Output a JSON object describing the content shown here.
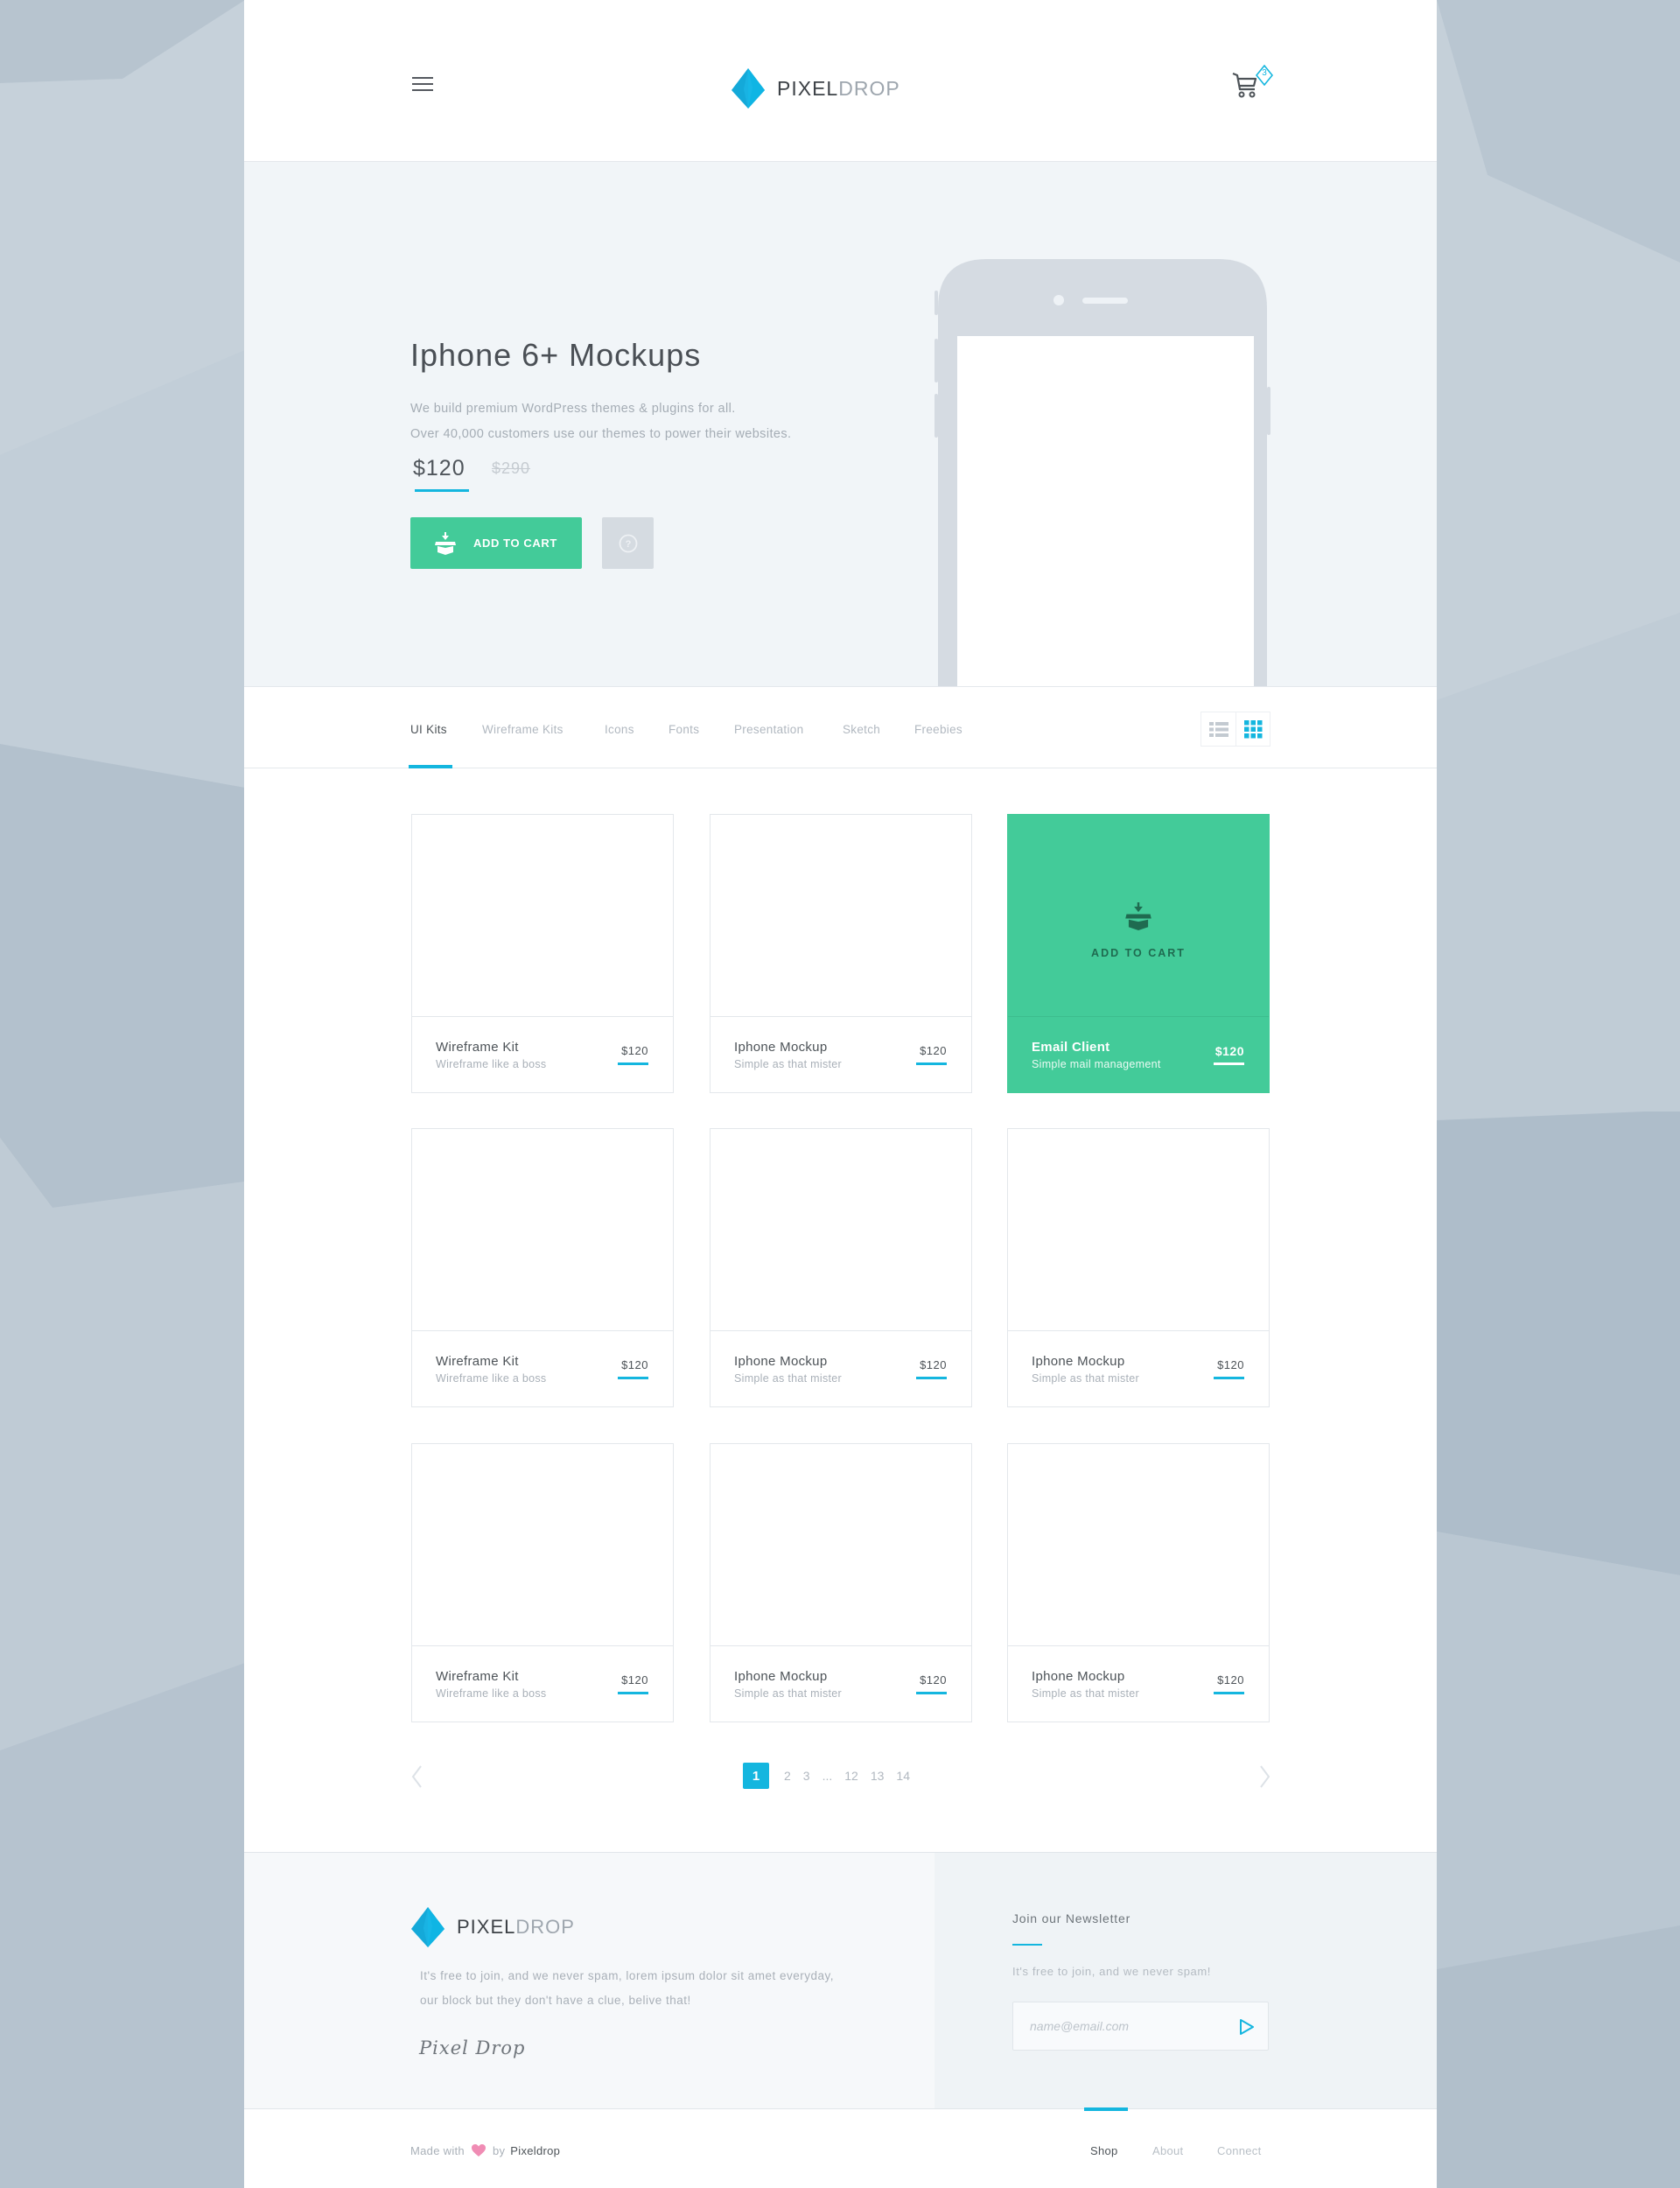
{
  "colors": {
    "accent": "#14b6df",
    "green": "#43cb99",
    "text_dark": "#4d5358",
    "text_muted": "#a9b0b8"
  },
  "header": {
    "brand_part1": "PIXEL",
    "brand_part2": "DROP",
    "cart_count": "3",
    "icons": [
      "menu-icon",
      "logo-diamond-icon",
      "cart-icon"
    ]
  },
  "hero": {
    "title": "Iphone 6+ Mockups",
    "description_line1": "We build premium WordPress themes & plugins for all.",
    "description_line2": "Over 40,000 customers use our themes to power their websites.",
    "price": "$120",
    "old_price": "$290",
    "add_to_cart_label": "ADD TO CART",
    "help_icon": "question-circle-icon"
  },
  "tabs": {
    "items": [
      {
        "label": "UI Kits",
        "active": true
      },
      {
        "label": "Wireframe Kits",
        "active": false
      },
      {
        "label": "Icons",
        "active": false
      },
      {
        "label": "Fonts",
        "active": false
      },
      {
        "label": "Presentation",
        "active": false
      },
      {
        "label": "Sketch",
        "active": false
      },
      {
        "label": "Freebies",
        "active": false
      }
    ],
    "view_modes": [
      "list-view",
      "grid-view"
    ],
    "active_view": "grid-view"
  },
  "products": [
    {
      "title": "Wireframe Kit",
      "subtitle": "Wireframe like a boss",
      "price": "$120"
    },
    {
      "title": "Iphone Mockup",
      "subtitle": "Simple as that mister",
      "price": "$120"
    },
    {
      "title": "Email Client",
      "subtitle": "Simple mail management",
      "price": "$120",
      "featured": true,
      "cta": "ADD TO CART"
    },
    {
      "title": "Wireframe Kit",
      "subtitle": "Wireframe like a boss",
      "price": "$120"
    },
    {
      "title": "Iphone Mockup",
      "subtitle": "Simple as that mister",
      "price": "$120"
    },
    {
      "title": "Iphone Mockup",
      "subtitle": "Simple as that mister",
      "price": "$120"
    },
    {
      "title": "Wireframe Kit",
      "subtitle": "Wireframe like a boss",
      "price": "$120"
    },
    {
      "title": "Iphone Mockup",
      "subtitle": "Simple as that mister",
      "price": "$120"
    },
    {
      "title": "Iphone Mockup",
      "subtitle": "Simple as that mister",
      "price": "$120"
    }
  ],
  "pagination": {
    "pages": [
      "1",
      "2",
      "3",
      "...",
      "12",
      "13",
      "14"
    ],
    "current": "1"
  },
  "footer": {
    "brand_part1": "PIXEL",
    "brand_part2": "DROP",
    "about_line1": "It's free to join, and we never spam, lorem ipsum dolor sit amet everyday,",
    "about_line2": "our block but they don't have a clue, belive that!",
    "signature": "Pixel Drop",
    "newsletter": {
      "title": "Join our Newsletter",
      "description": "It's free to join, and we never spam!",
      "placeholder": "name@email.com",
      "value": ""
    },
    "made_with_prefix": "Made with",
    "made_with_by": "by",
    "made_with_brand": "Pixeldrop",
    "nav": [
      {
        "label": "Shop",
        "active": true
      },
      {
        "label": "About",
        "active": false
      },
      {
        "label": "Connect",
        "active": false
      }
    ]
  }
}
